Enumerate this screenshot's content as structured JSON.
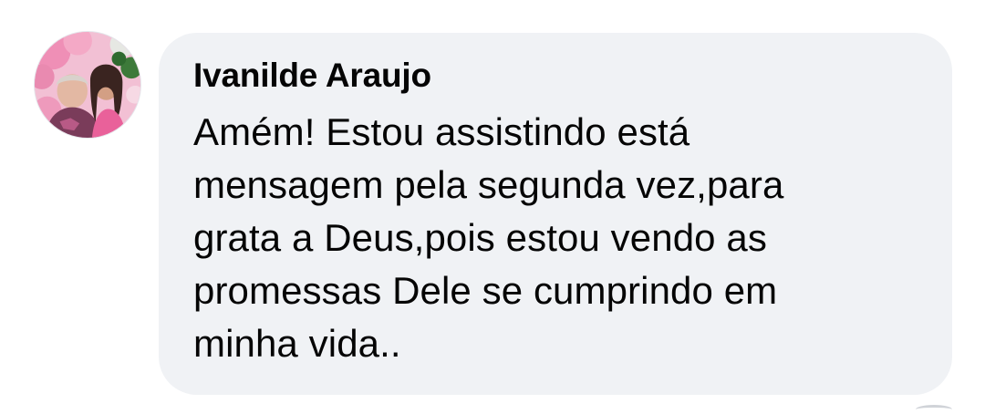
{
  "comment": {
    "author": "Ivanilde Araujo",
    "message_lines": [
      "Amém! Estou assistindo está",
      "mensagem pela segunda vez,para",
      "grata a Deus,pois estou vendo as",
      "promessas Dele se cumprindo em",
      "minha vida.."
    ],
    "avatar_icon": "profile-photo",
    "bubble_color": "#f0f2f5",
    "text_color": "#050505"
  }
}
